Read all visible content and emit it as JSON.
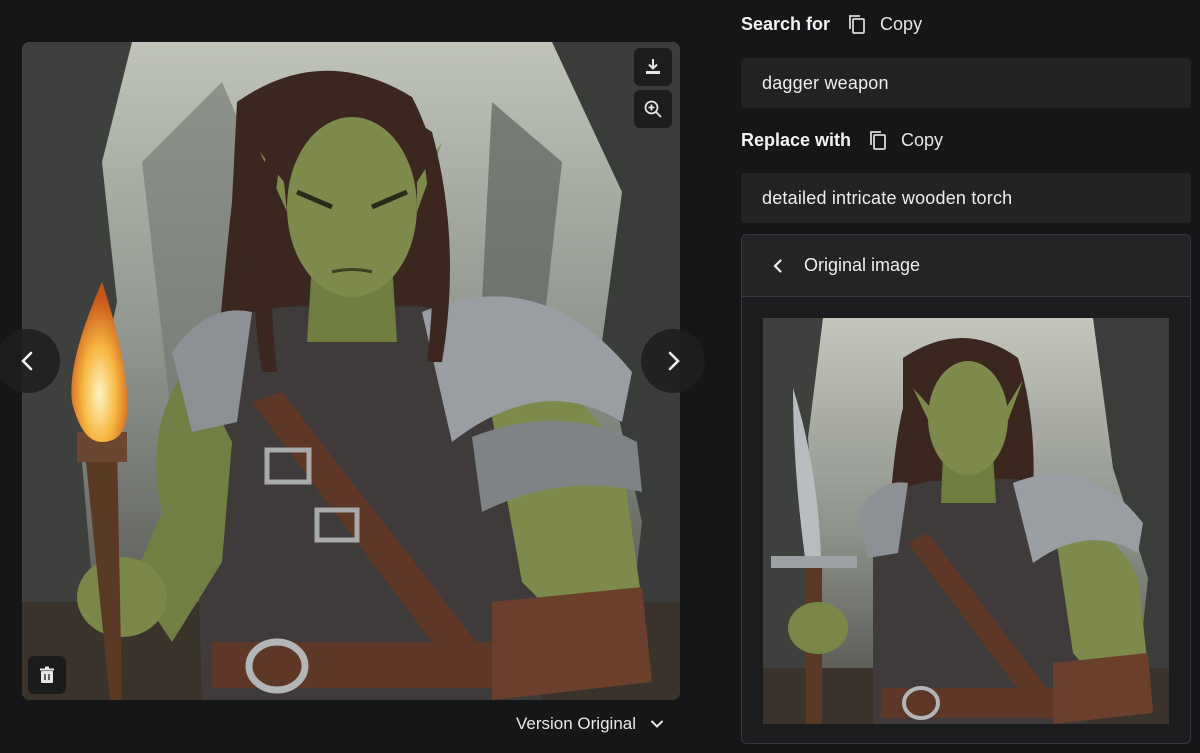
{
  "search": {
    "label": "Search for",
    "copy_label": "Copy",
    "value": "dagger weapon"
  },
  "replace": {
    "label": "Replace with",
    "copy_label": "Copy",
    "value": "detailed intricate wooden torch"
  },
  "original_panel": {
    "title": "Original image"
  },
  "version": {
    "selected": "Version Original"
  },
  "viewer": {
    "tools": [
      "download-icon",
      "zoom-in-icon",
      "trash-icon"
    ],
    "nav": [
      "chevron-left-icon",
      "chevron-right-icon"
    ]
  },
  "colors": {
    "background": "#151618",
    "field_bg": "#222325",
    "card_border": "#35373a",
    "skin": "#7d8a4c",
    "armor": "#9a9ea3",
    "leather": "#5e3726",
    "flame": "#f2a33a"
  }
}
